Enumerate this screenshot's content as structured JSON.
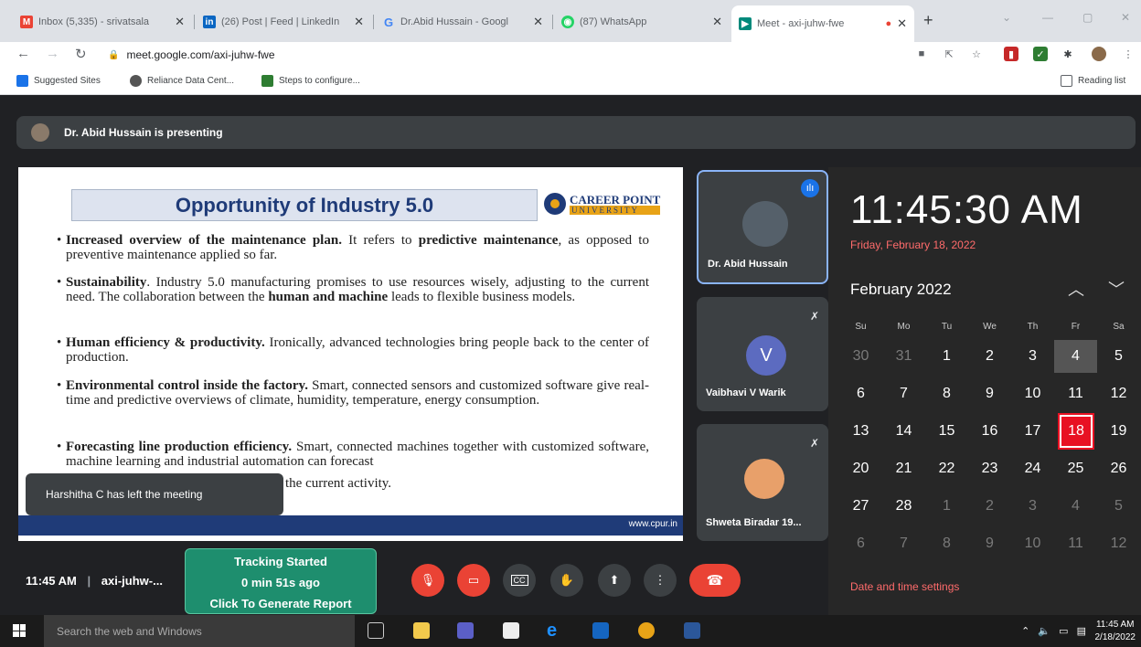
{
  "browser": {
    "tabs": [
      {
        "title": "Inbox (5,335) - srivatsala",
        "favicon": "gmail-icon",
        "color": "#ea4335"
      },
      {
        "title": "(26) Post | Feed | LinkedIn",
        "favicon": "linkedin-icon",
        "color": "#0a66c2"
      },
      {
        "title": "Dr.Abid Hussain - Googl",
        "favicon": "google-icon",
        "color": "#4285f4"
      },
      {
        "title": "(87) WhatsApp",
        "favicon": "whatsapp-icon",
        "color": "#25d366"
      },
      {
        "title": "Meet - axi-juhw-fwe",
        "favicon": "meet-icon",
        "color": "#00897b"
      }
    ],
    "url": "meet.google.com/axi-juhw-fwe",
    "bookmarks": [
      "Suggested Sites",
      "Reliance Data Cent...",
      "Steps to configure..."
    ],
    "reading_list": "Reading list"
  },
  "meet": {
    "presenting": "Dr. Abid Hussain is presenting",
    "slide": {
      "title": "Opportunity of Industry 5.0",
      "logo_line1": "CAREER POINT",
      "logo_line2": "UNIVERSITY",
      "bullets": [
        {
          "bold": "Increased overview of the maintenance plan.",
          "text": " It refers to ",
          "bold2": "predictive maintenance",
          "text2": ", as opposed to preventive maintenance applied so far."
        },
        {
          "bold": "Sustainability",
          "text": ". Industry 5.0 manufacturing promises to use resources wisely, adjusting to the current need. The collaboration between the ",
          "bold2": "human and machine",
          "text2": " leads to flexible business models."
        },
        {
          "bold": "Human efficiency & productivity.",
          "text": " Ironically, advanced technologies bring people back to the center of production.",
          "bold2": "",
          "text2": ""
        },
        {
          "bold": "Environmental control inside the factory.",
          "text": " Smart, connected sensors and customized software give real-time and predictive overviews of climate, humidity, temperature, energy consumption.",
          "bold2": "",
          "text2": ""
        },
        {
          "bold": "Forecasting line production efficiency.",
          "text": " Smart, connected machines together with customized software, machine learning and industrial automation can forecast",
          "bold2": "",
          "text2": ""
        }
      ],
      "bullet5_tail": "the current activity.",
      "footer_url": "www.cpur.in"
    },
    "toast": "Harshitha C has left the meeting",
    "participants": [
      {
        "name": "Dr. Abid Hussain"
      },
      {
        "name": "Vaibhavi V Warik",
        "initial": "V"
      },
      {
        "name": "Shweta Biradar 19..."
      }
    ],
    "meeting_time": "11:45 AM",
    "meeting_code": "axi-juhw-...",
    "tracking": {
      "line1": "Tracking Started",
      "line2": "0 min 51s ago",
      "line3": "Click To Generate Report"
    }
  },
  "clock": {
    "time": "11:45:30 AM",
    "date": "Friday, February 18, 2022",
    "month": "February 2022",
    "weekdays": [
      "Su",
      "Mo",
      "Tu",
      "We",
      "Th",
      "Fr",
      "Sa"
    ],
    "weeks": [
      [
        "30",
        "31",
        "1",
        "2",
        "3",
        "4",
        "5"
      ],
      [
        "6",
        "7",
        "8",
        "9",
        "10",
        "11",
        "12"
      ],
      [
        "13",
        "14",
        "15",
        "16",
        "17",
        "18",
        "19"
      ],
      [
        "20",
        "21",
        "22",
        "23",
        "24",
        "25",
        "26"
      ],
      [
        "27",
        "28",
        "1",
        "2",
        "3",
        "4",
        "5"
      ],
      [
        "6",
        "7",
        "8",
        "9",
        "10",
        "11",
        "12"
      ]
    ],
    "today": "18",
    "settings_link": "Date and time settings"
  },
  "taskbar": {
    "search": "Search the web and Windows",
    "time": "11:45 AM",
    "date": "2/18/2022"
  }
}
